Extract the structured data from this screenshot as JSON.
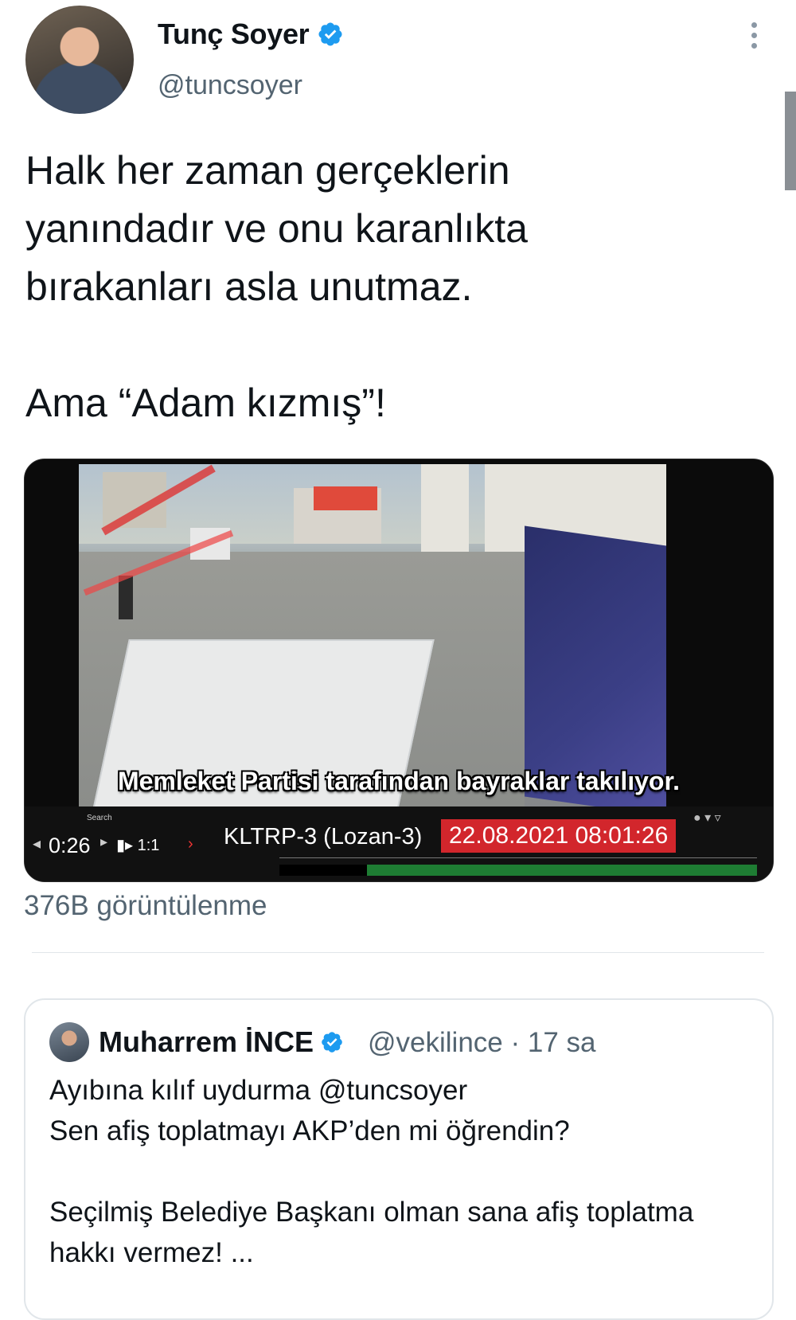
{
  "author": {
    "name": "Tunç Soyer",
    "handle": "@tuncsoyer"
  },
  "tweet": {
    "text": "Halk her zaman gerçeklerin\nyanındadır ve onu karanlıkta\nbırakanları asla unutmaz.\n\nAma “Adam kızmış”!"
  },
  "video": {
    "caption": "Memleket Partisi tarafından bayraklar takılıyor.",
    "elapsed": "0:26",
    "playback_speed": "1:1",
    "camera_label": "KLTRP-3 (Lozan-3)",
    "timestamp": "22.08.2021 08:01:26",
    "search_label": "Search"
  },
  "stats": {
    "views": "376B görüntülenme"
  },
  "quoted_tweet": {
    "name": "Muharrem İNCE",
    "handle_time": "@vekilince · 17 sa",
    "text": "Ayıbına kılıf uydurma @tuncsoyer\nSen afiş toplatmayı AKP’den mi öğrendin?\n\nSeçilmiş Belediye Başkanı olman sana afiş toplatma\nhakkı vermez! ..."
  },
  "colors": {
    "verified": "#1d9bf0",
    "secondary_text": "#536471",
    "timestamp_bg": "#d2262c"
  }
}
